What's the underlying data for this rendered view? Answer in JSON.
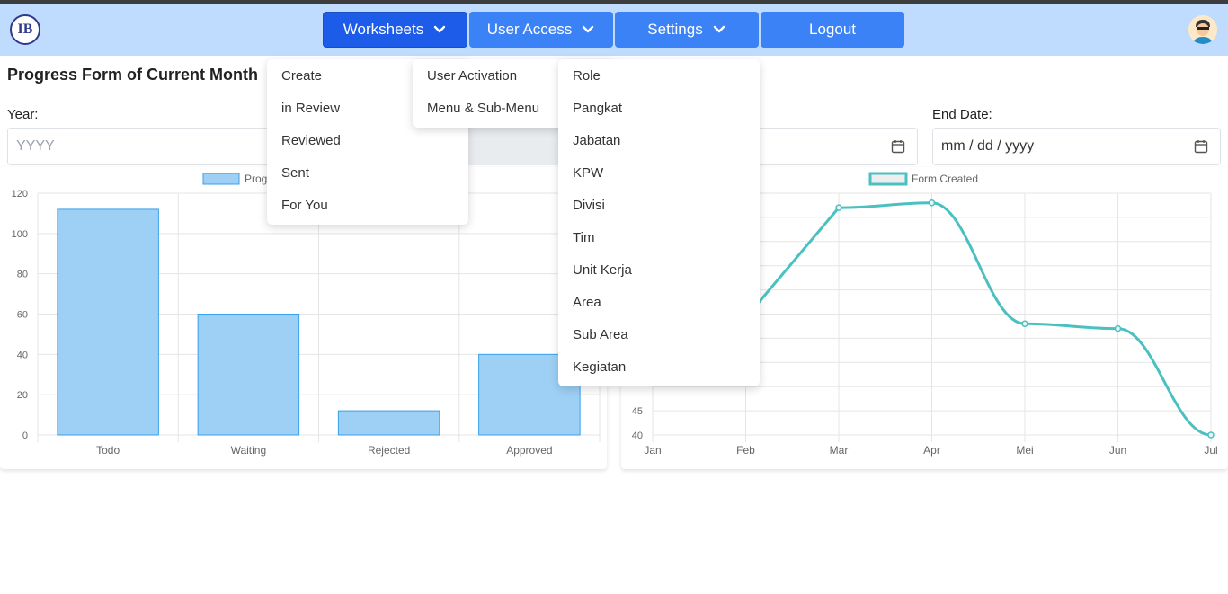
{
  "nav": {
    "logo_text": "IB",
    "worksheets": "Worksheets",
    "user_access": "User Access",
    "settings": "Settings",
    "logout": "Logout"
  },
  "menus": {
    "worksheets": [
      "Create",
      "in Review",
      "Reviewed",
      "Sent",
      "For You"
    ],
    "user_access": [
      "User Activation",
      "Menu & Sub-Menu"
    ],
    "settings": [
      "Role",
      "Pangkat",
      "Jabatan",
      "KPW",
      "Divisi",
      "Tim",
      "Unit Kerja",
      "Area",
      "Sub Area",
      "Kegiatan"
    ]
  },
  "page": {
    "title": "Progress Form of Current Month",
    "year_label": "Year:",
    "year_placeholder": "YYYY",
    "end_date_label": "End Date:",
    "date_placeholder": "mm / dd / yyyy"
  },
  "chart_data": [
    {
      "type": "bar",
      "categories": [
        "Todo",
        "Waiting",
        "Rejected",
        "Approved"
      ],
      "series": [
        {
          "name": "Prog",
          "values": [
            112,
            60,
            12,
            40
          ]
        }
      ],
      "ylim": [
        0,
        120
      ],
      "yticks": [
        0,
        20,
        40,
        60,
        80,
        100,
        120
      ],
      "color": "#9ecff5",
      "border": "#36a2eb",
      "grid": true,
      "legend": "top"
    },
    {
      "type": "line",
      "categories": [
        "Jan",
        "Feb",
        "Mar",
        "Apr",
        "Mei",
        "Jun",
        "Jul"
      ],
      "series": [
        {
          "name": "Form Created",
          "values": [
            null,
            null,
            87,
            88,
            63,
            62,
            40
          ]
        }
      ],
      "yticks": [
        40,
        45
      ],
      "ylim": [
        40,
        90
      ],
      "color": "#4bc0c0",
      "grid": true,
      "legend": "top"
    }
  ]
}
